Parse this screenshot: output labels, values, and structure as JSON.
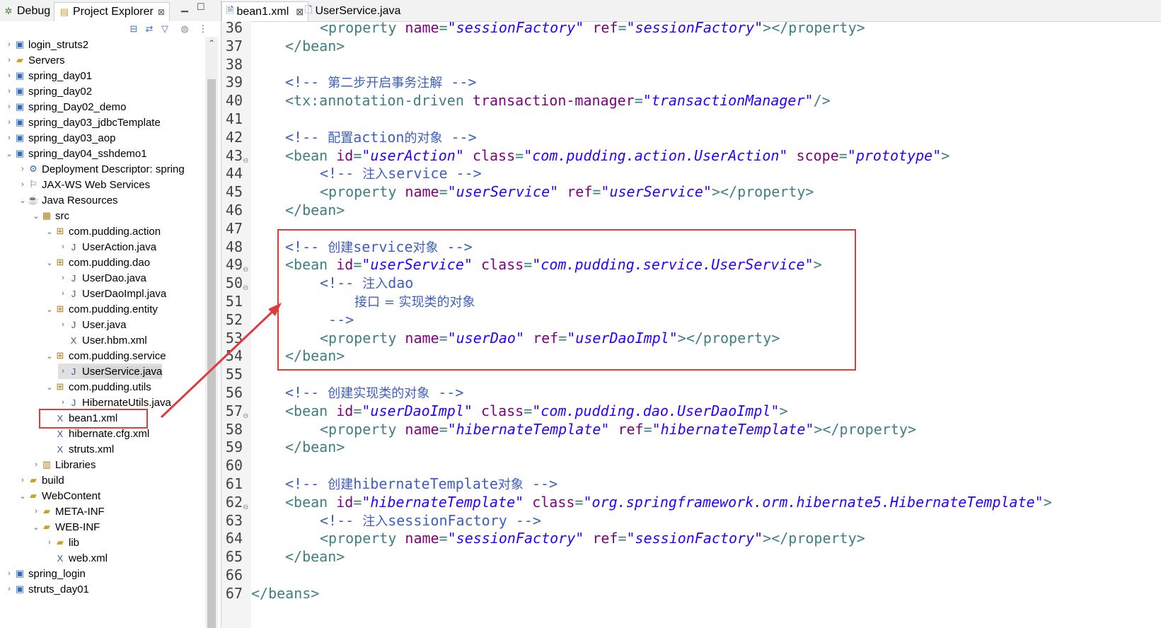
{
  "left_tabs": [
    {
      "label": "Debug"
    },
    {
      "label": "Project Explorer"
    }
  ],
  "tree": [
    {
      "label": "login_struts2",
      "depth": 0,
      "twisty": "collapsed",
      "icon": "project-icon"
    },
    {
      "label": "Servers",
      "depth": 0,
      "twisty": "collapsed",
      "icon": "folder-icon"
    },
    {
      "label": "spring_day01",
      "depth": 0,
      "twisty": "collapsed",
      "icon": "project-icon"
    },
    {
      "label": "spring_day02",
      "depth": 0,
      "twisty": "collapsed",
      "icon": "project-icon"
    },
    {
      "label": "spring_Day02_demo",
      "depth": 0,
      "twisty": "collapsed",
      "icon": "project-icon"
    },
    {
      "label": "spring_day03_jdbcTemplate",
      "depth": 0,
      "twisty": "collapsed",
      "icon": "project-icon"
    },
    {
      "label": "spring_day03_aop",
      "depth": 0,
      "twisty": "collapsed",
      "icon": "project-icon"
    },
    {
      "label": "spring_day04_sshdemo1",
      "depth": 0,
      "twisty": "expanded",
      "icon": "project-icon"
    },
    {
      "label": "Deployment Descriptor: spring",
      "depth": 1,
      "twisty": "collapsed",
      "icon": "descriptor-icon"
    },
    {
      "label": "JAX-WS Web Services",
      "depth": 1,
      "twisty": "collapsed",
      "icon": "webservice-icon"
    },
    {
      "label": "Java Resources",
      "depth": 1,
      "twisty": "expanded",
      "icon": "java-resources-icon"
    },
    {
      "label": "src",
      "depth": 2,
      "twisty": "expanded",
      "icon": "source-folder-icon"
    },
    {
      "label": "com.pudding.action",
      "depth": 3,
      "twisty": "expanded",
      "icon": "package-icon"
    },
    {
      "label": "UserAction.java",
      "depth": 4,
      "twisty": "collapsed",
      "icon": "java-file-icon"
    },
    {
      "label": "com.pudding.dao",
      "depth": 3,
      "twisty": "expanded",
      "icon": "package-icon"
    },
    {
      "label": "UserDao.java",
      "depth": 4,
      "twisty": "collapsed",
      "icon": "java-file-icon"
    },
    {
      "label": "UserDaoImpl.java",
      "depth": 4,
      "twisty": "collapsed",
      "icon": "java-file-icon"
    },
    {
      "label": "com.pudding.entity",
      "depth": 3,
      "twisty": "expanded",
      "icon": "package-icon"
    },
    {
      "label": "User.java",
      "depth": 4,
      "twisty": "collapsed",
      "icon": "java-file-icon"
    },
    {
      "label": "User.hbm.xml",
      "depth": 4,
      "twisty": "none",
      "icon": "xml-file-icon"
    },
    {
      "label": "com.pudding.service",
      "depth": 3,
      "twisty": "expanded",
      "icon": "package-icon"
    },
    {
      "label": "UserService.java",
      "depth": 4,
      "twisty": "collapsed",
      "icon": "java-file-icon",
      "selected": true
    },
    {
      "label": "com.pudding.utils",
      "depth": 3,
      "twisty": "expanded",
      "icon": "package-icon"
    },
    {
      "label": "HibernateUtils.java",
      "depth": 4,
      "twisty": "collapsed",
      "icon": "java-file-icon"
    },
    {
      "label": "bean1.xml",
      "depth": 3,
      "twisty": "none",
      "icon": "xml-file-icon"
    },
    {
      "label": "hibernate.cfg.xml",
      "depth": 3,
      "twisty": "none",
      "icon": "xml-file-icon"
    },
    {
      "label": "struts.xml",
      "depth": 3,
      "twisty": "none",
      "icon": "xml-file-icon"
    },
    {
      "label": "Libraries",
      "depth": 2,
      "twisty": "collapsed",
      "icon": "library-icon"
    },
    {
      "label": "build",
      "depth": 1,
      "twisty": "collapsed",
      "icon": "folder-icon"
    },
    {
      "label": "WebContent",
      "depth": 1,
      "twisty": "expanded",
      "icon": "folder-icon"
    },
    {
      "label": "META-INF",
      "depth": 2,
      "twisty": "collapsed",
      "icon": "folder-icon"
    },
    {
      "label": "WEB-INF",
      "depth": 2,
      "twisty": "expanded",
      "icon": "folder-icon"
    },
    {
      "label": "lib",
      "depth": 3,
      "twisty": "collapsed",
      "icon": "folder-icon"
    },
    {
      "label": "web.xml",
      "depth": 3,
      "twisty": "none",
      "icon": "xml-file-icon"
    },
    {
      "label": "spring_login",
      "depth": 0,
      "twisty": "collapsed",
      "icon": "project-icon"
    },
    {
      "label": "struts_day01",
      "depth": 0,
      "twisty": "collapsed",
      "icon": "project-icon"
    }
  ],
  "editor_tabs": [
    {
      "label": "bean1.xml",
      "active": true
    },
    {
      "label": "UserService.java",
      "active": false
    }
  ],
  "code_lines": [
    {
      "n": "36",
      "indent": 2,
      "fold": false,
      "parts": [
        [
          "tg",
          "<"
        ],
        [
          "tg",
          "property "
        ],
        [
          "at",
          "name"
        ],
        [
          "tg",
          "="
        ],
        [
          "av",
          "\"sessionFactory\""
        ],
        [
          "tg",
          " "
        ],
        [
          "at",
          "ref"
        ],
        [
          "tg",
          "="
        ],
        [
          "av",
          "\"sessionFactory\""
        ],
        [
          "tg",
          "></property>"
        ]
      ]
    },
    {
      "n": "37",
      "indent": 1,
      "fold": false,
      "parts": [
        [
          "tg",
          "</bean>"
        ]
      ]
    },
    {
      "n": "38",
      "indent": 0,
      "fold": false,
      "parts": []
    },
    {
      "n": "39",
      "indent": 1,
      "fold": false,
      "parts": [
        [
          "cm",
          "<!-- "
        ],
        [
          "cmz",
          "第二步开启事务注解"
        ],
        [
          "cm",
          " -->"
        ]
      ]
    },
    {
      "n": "40",
      "indent": 1,
      "fold": false,
      "parts": [
        [
          "tg",
          "<tx:annotation-driven "
        ],
        [
          "at",
          "transaction-manager"
        ],
        [
          "tg",
          "="
        ],
        [
          "av",
          "\"transactionManager\""
        ],
        [
          "tg",
          "/>"
        ]
      ]
    },
    {
      "n": "41",
      "indent": 0,
      "fold": false,
      "parts": []
    },
    {
      "n": "42",
      "indent": 1,
      "fold": false,
      "parts": [
        [
          "cm",
          "<!-- "
        ],
        [
          "cmz",
          "配置"
        ],
        [
          "cm",
          "action"
        ],
        [
          "cmz",
          "的对象"
        ],
        [
          "cm",
          " -->"
        ]
      ]
    },
    {
      "n": "43",
      "indent": 1,
      "fold": true,
      "parts": [
        [
          "tg",
          "<bean "
        ],
        [
          "at",
          "id"
        ],
        [
          "tg",
          "="
        ],
        [
          "av",
          "\"userAction\""
        ],
        [
          "tg",
          " "
        ],
        [
          "at",
          "class"
        ],
        [
          "tg",
          "="
        ],
        [
          "av",
          "\"com.pudding.action.UserAction\""
        ],
        [
          "tg",
          " "
        ],
        [
          "at",
          "scope"
        ],
        [
          "tg",
          "="
        ],
        [
          "av",
          "\"prototype\""
        ],
        [
          "tg",
          ">"
        ]
      ]
    },
    {
      "n": "44",
      "indent": 2,
      "fold": false,
      "parts": [
        [
          "cm",
          "<!-- "
        ],
        [
          "cmz",
          "注入"
        ],
        [
          "cm",
          "service -->"
        ]
      ]
    },
    {
      "n": "45",
      "indent": 2,
      "fold": false,
      "parts": [
        [
          "tg",
          "<property "
        ],
        [
          "at",
          "name"
        ],
        [
          "tg",
          "="
        ],
        [
          "av",
          "\"userService\""
        ],
        [
          "tg",
          " "
        ],
        [
          "at",
          "ref"
        ],
        [
          "tg",
          "="
        ],
        [
          "av",
          "\"userService\""
        ],
        [
          "tg",
          "></property>"
        ]
      ]
    },
    {
      "n": "46",
      "indent": 1,
      "fold": false,
      "parts": [
        [
          "tg",
          "</bean>"
        ]
      ]
    },
    {
      "n": "47",
      "indent": 0,
      "fold": false,
      "parts": []
    },
    {
      "n": "48",
      "indent": 1,
      "fold": false,
      "parts": [
        [
          "cm",
          "<!-- "
        ],
        [
          "cmz",
          "创建"
        ],
        [
          "cm",
          "service"
        ],
        [
          "cmz",
          "对象"
        ],
        [
          "cm",
          " -->"
        ]
      ]
    },
    {
      "n": "49",
      "indent": 1,
      "fold": true,
      "parts": [
        [
          "tg",
          "<bean "
        ],
        [
          "at",
          "id"
        ],
        [
          "tg",
          "="
        ],
        [
          "av",
          "\"userService\""
        ],
        [
          "tg",
          " "
        ],
        [
          "at",
          "class"
        ],
        [
          "tg",
          "="
        ],
        [
          "av",
          "\"com.pudding.service.UserService\""
        ],
        [
          "tg",
          ">"
        ]
      ]
    },
    {
      "n": "50",
      "indent": 2,
      "fold": true,
      "parts": [
        [
          "cm",
          "<!-- "
        ],
        [
          "cmz",
          "注入"
        ],
        [
          "cm",
          "dao"
        ]
      ]
    },
    {
      "n": "51",
      "indent": 3,
      "fold": false,
      "parts": [
        [
          "cmz",
          "接口 = 实现类的对象"
        ]
      ]
    },
    {
      "n": "52",
      "indent": 2,
      "fold": false,
      "parts": [
        [
          "cm",
          " -->"
        ]
      ]
    },
    {
      "n": "53",
      "indent": 2,
      "fold": false,
      "parts": [
        [
          "tg",
          "<property "
        ],
        [
          "at",
          "name"
        ],
        [
          "tg",
          "="
        ],
        [
          "av",
          "\"userDao\""
        ],
        [
          "tg",
          " "
        ],
        [
          "at",
          "ref"
        ],
        [
          "tg",
          "="
        ],
        [
          "av",
          "\"userDaoImpl\""
        ],
        [
          "tg",
          "></property>"
        ]
      ]
    },
    {
      "n": "54",
      "indent": 1,
      "fold": false,
      "parts": [
        [
          "tg",
          "</bean>"
        ]
      ]
    },
    {
      "n": "55",
      "indent": 0,
      "fold": false,
      "parts": []
    },
    {
      "n": "56",
      "indent": 1,
      "fold": false,
      "parts": [
        [
          "cm",
          "<!-- "
        ],
        [
          "cmz",
          "创建实现类的对象"
        ],
        [
          "cm",
          " -->"
        ]
      ]
    },
    {
      "n": "57",
      "indent": 1,
      "fold": true,
      "parts": [
        [
          "tg",
          "<bean "
        ],
        [
          "at",
          "id"
        ],
        [
          "tg",
          "="
        ],
        [
          "av",
          "\"userDaoImpl\""
        ],
        [
          "tg",
          " "
        ],
        [
          "at",
          "class"
        ],
        [
          "tg",
          "="
        ],
        [
          "av",
          "\"com.pudding.dao.UserDaoImpl\""
        ],
        [
          "tg",
          ">"
        ]
      ]
    },
    {
      "n": "58",
      "indent": 2,
      "fold": false,
      "parts": [
        [
          "tg",
          "<property "
        ],
        [
          "at",
          "name"
        ],
        [
          "tg",
          "="
        ],
        [
          "av",
          "\"hibernateTemplate\""
        ],
        [
          "tg",
          " "
        ],
        [
          "at",
          "ref"
        ],
        [
          "tg",
          "="
        ],
        [
          "av",
          "\"hibernateTemplate\""
        ],
        [
          "tg",
          "></property>"
        ]
      ]
    },
    {
      "n": "59",
      "indent": 1,
      "fold": false,
      "parts": [
        [
          "tg",
          "</bean>"
        ]
      ]
    },
    {
      "n": "60",
      "indent": 0,
      "fold": false,
      "parts": []
    },
    {
      "n": "61",
      "indent": 1,
      "fold": false,
      "parts": [
        [
          "cm",
          "<!-- "
        ],
        [
          "cmz",
          "创建"
        ],
        [
          "cm",
          "hibernateTemplate"
        ],
        [
          "cmz",
          "对象"
        ],
        [
          "cm",
          " -->"
        ]
      ]
    },
    {
      "n": "62",
      "indent": 1,
      "fold": true,
      "parts": [
        [
          "tg",
          "<bean "
        ],
        [
          "at",
          "id"
        ],
        [
          "tg",
          "="
        ],
        [
          "av",
          "\"hibernateTemplate\""
        ],
        [
          "tg",
          " "
        ],
        [
          "at",
          "class"
        ],
        [
          "tg",
          "="
        ],
        [
          "av",
          "\"org.springframework.orm.hibernate5.HibernateTemplate\""
        ],
        [
          "tg",
          ">"
        ]
      ]
    },
    {
      "n": "63",
      "indent": 2,
      "fold": false,
      "parts": [
        [
          "cm",
          "<!-- "
        ],
        [
          "cmz",
          "注入"
        ],
        [
          "cm",
          "sessionFactory -->"
        ]
      ]
    },
    {
      "n": "64",
      "indent": 2,
      "fold": false,
      "parts": [
        [
          "tg",
          "<property "
        ],
        [
          "at",
          "name"
        ],
        [
          "tg",
          "="
        ],
        [
          "av",
          "\"sessionFactory\""
        ],
        [
          "tg",
          " "
        ],
        [
          "at",
          "ref"
        ],
        [
          "tg",
          "="
        ],
        [
          "av",
          "\"sessionFactory\""
        ],
        [
          "tg",
          "></property>"
        ]
      ]
    },
    {
      "n": "65",
      "indent": 1,
      "fold": false,
      "parts": [
        [
          "tg",
          "</bean>"
        ]
      ]
    },
    {
      "n": "66",
      "indent": 0,
      "fold": false,
      "parts": []
    },
    {
      "n": "67",
      "indent": 0,
      "fold": false,
      "parts": [
        [
          "tg",
          "</beans>"
        ]
      ]
    }
  ],
  "colors": {
    "highlight_box": "#e03a3a",
    "comment": "#3f5fbf",
    "tag": "#3f7f7f",
    "attribute": "#7f007f",
    "value": "#2a00ff"
  }
}
